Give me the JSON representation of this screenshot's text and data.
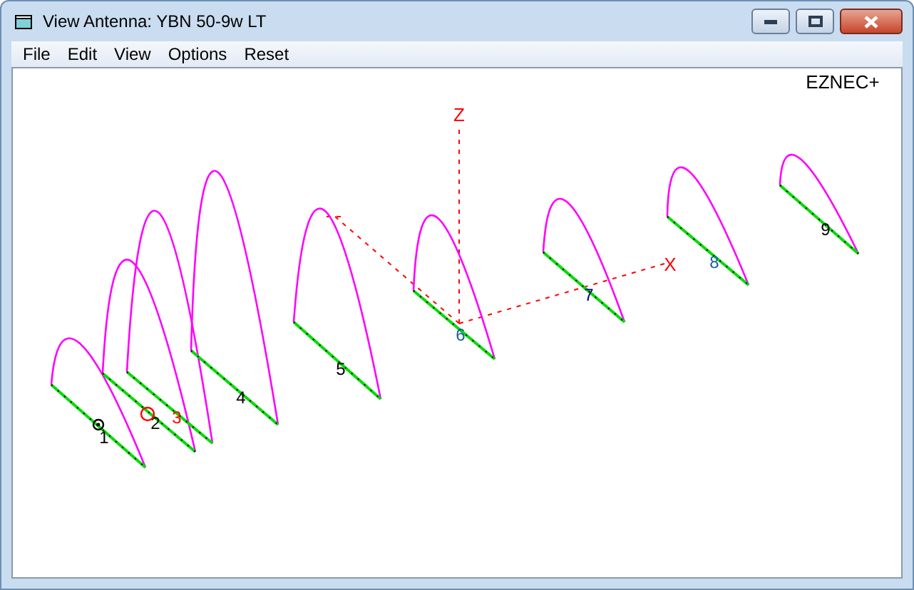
{
  "window": {
    "title": "View Antenna: YBN 50-9w LT"
  },
  "menu": [
    "File",
    "Edit",
    "View",
    "Options",
    "Reset"
  ],
  "canvas": {
    "brand": "EZNEC+",
    "axes": [
      {
        "label": "Z"
      },
      {
        "label": "X"
      }
    ],
    "elements": [
      {
        "label": "1",
        "color": "#000000",
        "source": true
      },
      {
        "label": "2",
        "color": "#000000",
        "load": true
      },
      {
        "label": "3",
        "color": "#ff0000"
      },
      {
        "label": "4",
        "color": "#000000"
      },
      {
        "label": "5",
        "color": "#000000"
      },
      {
        "label": "6",
        "color": "#1f5fa0"
      },
      {
        "label": "7",
        "color": "#000080"
      },
      {
        "label": "8",
        "color": "#1f5fa0"
      },
      {
        "label": "9",
        "color": "#000000"
      }
    ]
  }
}
